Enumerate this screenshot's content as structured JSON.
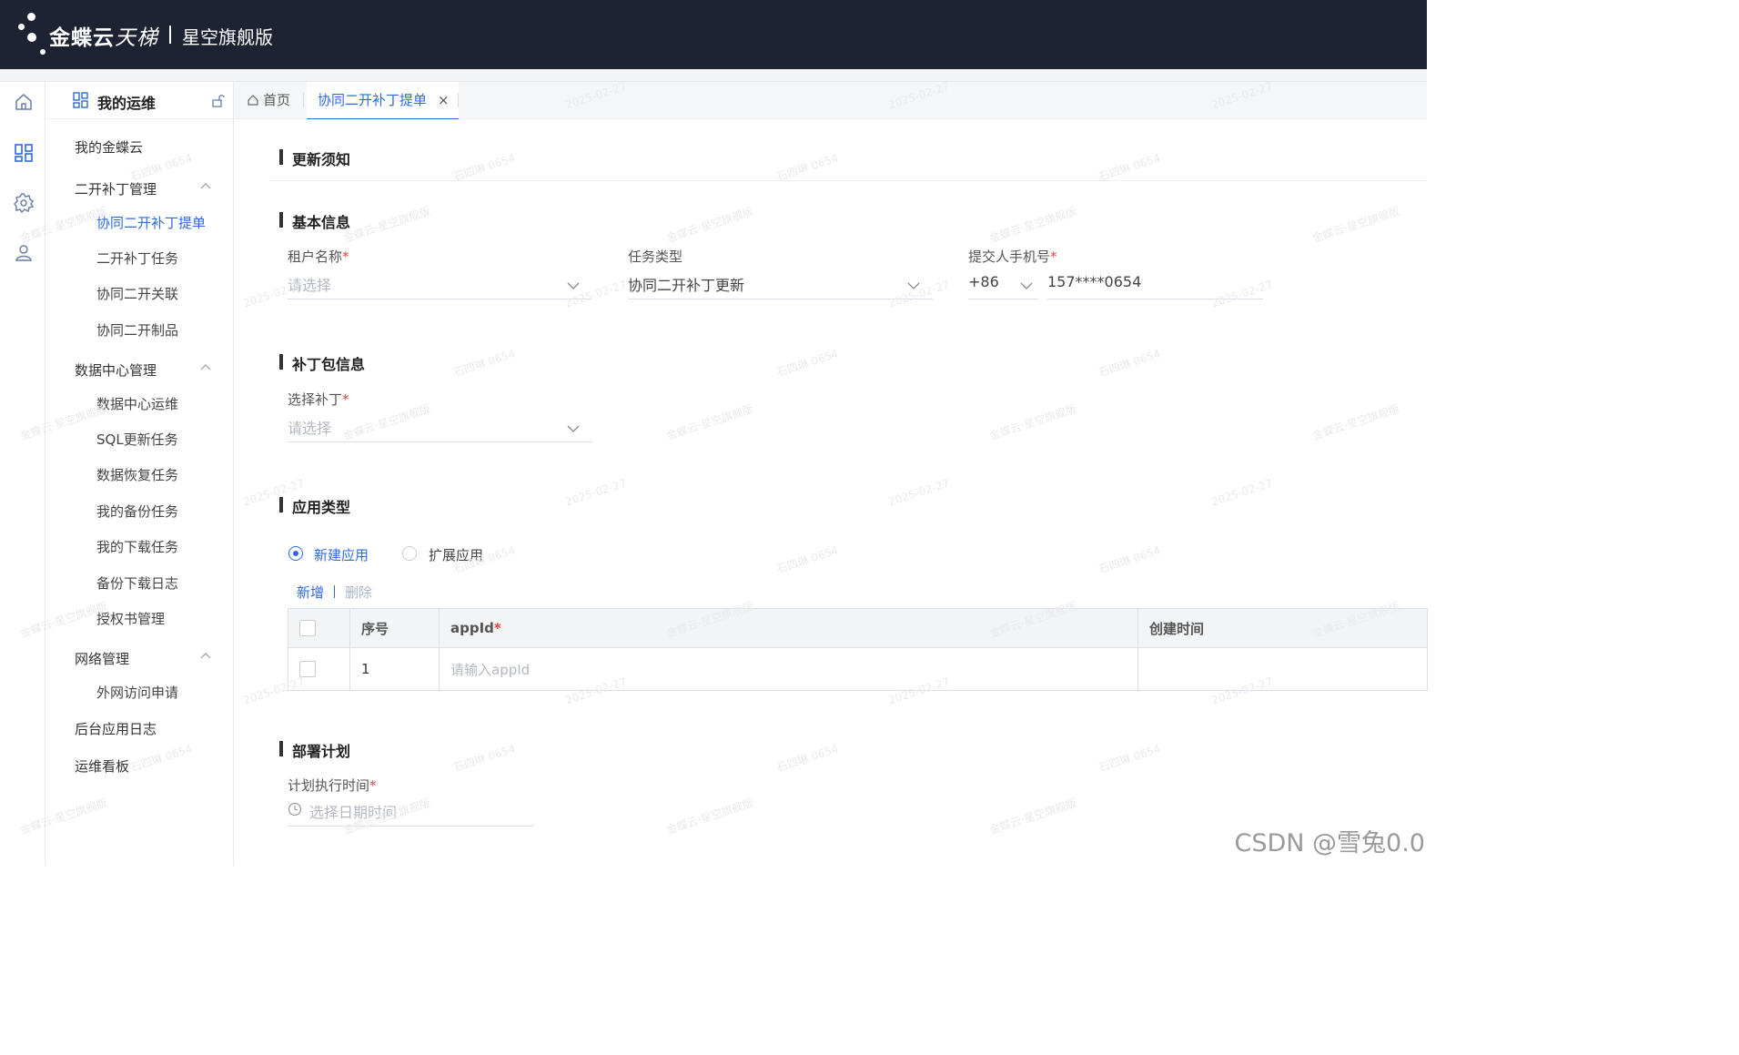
{
  "header": {
    "brand_bold": "金蝶云",
    "brand_light": "天梯",
    "edition": "星空旗舰版"
  },
  "sidebar": {
    "title": "我的运维",
    "items": [
      {
        "label": "我的金蝶云",
        "level": 1
      },
      {
        "label": "二开补丁管理",
        "level": 1,
        "expanded": true
      },
      {
        "label": "协同二开补丁提单",
        "level": 2,
        "active": true
      },
      {
        "label": "二开补丁任务",
        "level": 2
      },
      {
        "label": "协同二开关联",
        "level": 2
      },
      {
        "label": "协同二开制品",
        "level": 2
      },
      {
        "label": "数据中心管理",
        "level": 1,
        "expanded": true
      },
      {
        "label": "数据中心运维",
        "level": 2
      },
      {
        "label": "SQL更新任务",
        "level": 2
      },
      {
        "label": "数据恢复任务",
        "level": 2
      },
      {
        "label": "我的备份任务",
        "level": 2
      },
      {
        "label": "我的下载任务",
        "level": 2
      },
      {
        "label": "备份下载日志",
        "level": 2
      },
      {
        "label": "授权书管理",
        "level": 2
      },
      {
        "label": "网络管理",
        "level": 1,
        "expanded": true
      },
      {
        "label": "外网访问申请",
        "level": 2
      },
      {
        "label": "后台应用日志",
        "level": 1
      },
      {
        "label": "运维看板",
        "level": 1
      }
    ]
  },
  "rail": {
    "icons": [
      "home-icon",
      "apps-grid-icon",
      "settings-gear-icon",
      "user-icon"
    ]
  },
  "tabs": {
    "home": "首页",
    "active": "协同二开补丁提单",
    "close": "×"
  },
  "form": {
    "sections": {
      "notice": "更新须知",
      "basic": "基本信息",
      "patch": "补丁包信息",
      "app_type": "应用类型",
      "deploy": "部署计划"
    },
    "tenant": {
      "label": "租户名称",
      "placeholder": "请选择"
    },
    "task_type": {
      "label": "任务类型",
      "value": "协同二开补丁更新"
    },
    "phone": {
      "label": "提交人手机号",
      "country_code": "+86",
      "value": "157****0654"
    },
    "patch": {
      "label": "选择补丁",
      "placeholder": "请选择"
    },
    "app_options": [
      {
        "label": "新建应用",
        "selected": true
      },
      {
        "label": "扩展应用",
        "selected": false
      }
    ],
    "actions": {
      "add": "新增",
      "delete": "删除"
    },
    "table": {
      "headers": {
        "seq": "序号",
        "appid": "appId",
        "created": "创建时间"
      },
      "rows": [
        {
          "seq": "1",
          "appid_placeholder": "请输入appId",
          "created": ""
        }
      ]
    },
    "schedule": {
      "label": "计划执行时间",
      "placeholder": "选择日期时间"
    },
    "required_mark": "*"
  },
  "watermark": {
    "date": "2025-02-27",
    "user": "石四琳 0654",
    "product": "金蝶云·星空旗舰版"
  },
  "footer_credit": "CSDN @雪兔0.0",
  "colors": {
    "header_bg": "#1d2333",
    "accent": "#2f6bde",
    "required": "#e54545"
  }
}
